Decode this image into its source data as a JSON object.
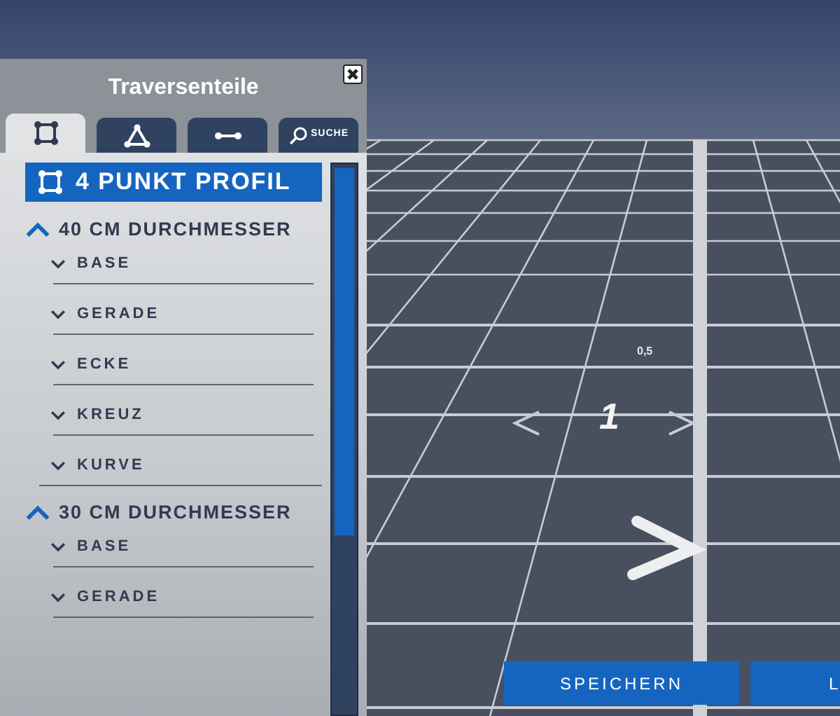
{
  "window": {
    "title": "Traversenteile"
  },
  "tabs": [
    {
      "kind": "square",
      "selected": true
    },
    {
      "kind": "triangle",
      "selected": false
    },
    {
      "kind": "line",
      "selected": false
    },
    {
      "kind": "search",
      "label": "SUCHE",
      "selected": false
    }
  ],
  "category": {
    "label": "4 PUNKT PROFIL"
  },
  "groups": [
    {
      "label": "40 CM DURCHMESSER",
      "expanded": true,
      "children": [
        {
          "label": "BASE",
          "expanded": false
        },
        {
          "label": "GERADE",
          "expanded": false
        },
        {
          "label": "ECKE",
          "expanded": false
        },
        {
          "label": "KREUZ",
          "expanded": false
        },
        {
          "label": "KURVE",
          "expanded": false
        }
      ]
    },
    {
      "label": "30 CM DURCHMESSER",
      "expanded": true,
      "children": [
        {
          "label": "BASE",
          "expanded": false
        },
        {
          "label": "GERADE",
          "expanded": false
        }
      ]
    }
  ],
  "scene": {
    "small_label": "0,5",
    "big_label": "1"
  },
  "buttons": [
    "SPEICHERN",
    "L"
  ]
}
